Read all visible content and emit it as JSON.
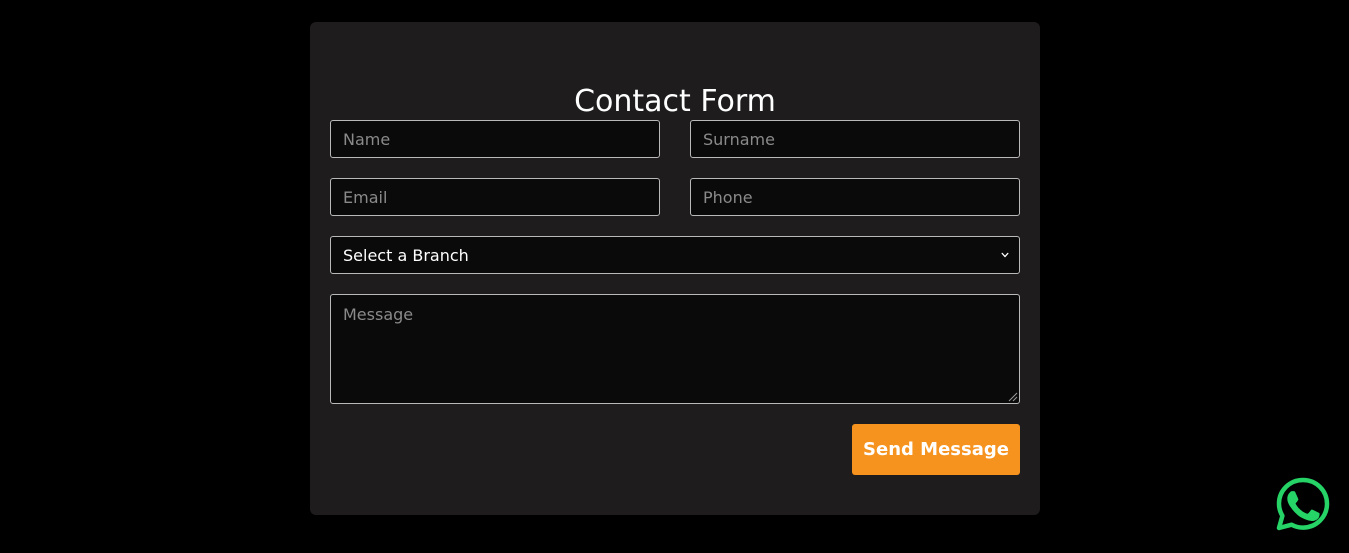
{
  "form": {
    "title": "Contact Form",
    "name_placeholder": "Name",
    "surname_placeholder": "Surname",
    "email_placeholder": "Email",
    "phone_placeholder": "Phone",
    "branch_selected": "Select a Branch",
    "message_placeholder": "Message",
    "submit_label": "Send Message"
  },
  "colors": {
    "page_background": "#000000",
    "card_background": "#1e1c1d",
    "accent": "#f6931e",
    "whatsapp": "#25d366"
  },
  "icons": {
    "select_arrow": "chevron-down-icon",
    "textarea_resize": "resize-grip-icon",
    "floating_chat": "whatsapp-icon"
  }
}
